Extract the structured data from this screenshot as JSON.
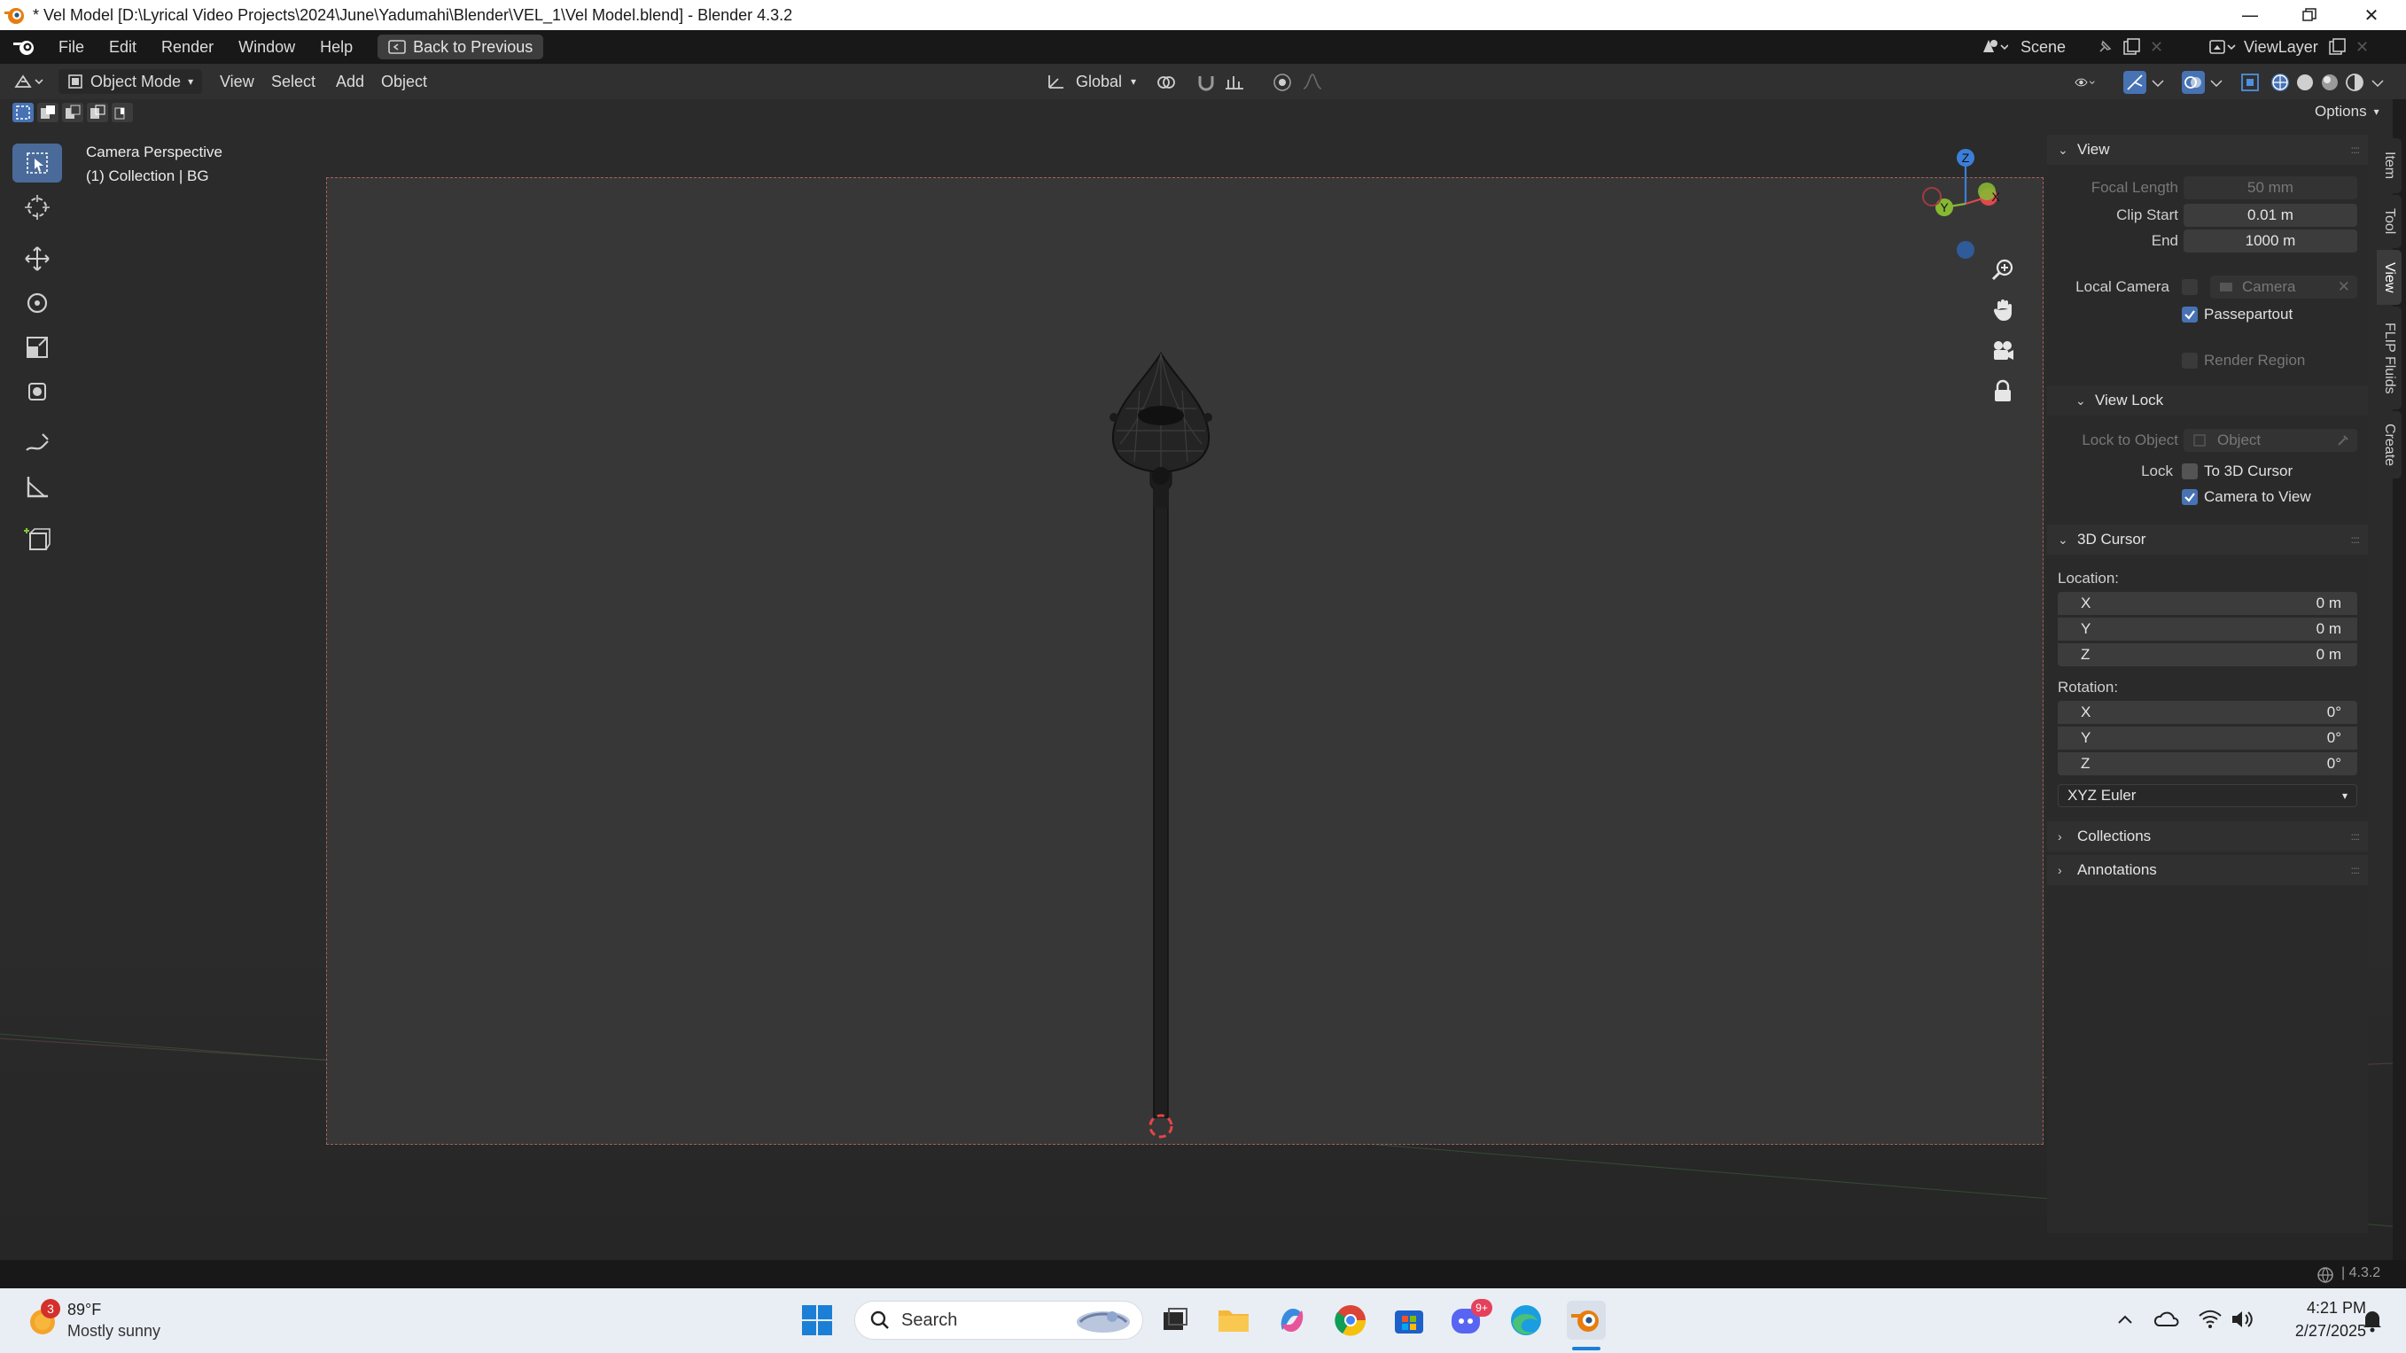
{
  "window": {
    "title": "* Vel Model [D:\\Lyrical Video Projects\\2024\\June\\Yadumahi\\Blender\\VEL_1\\Vel Model.blend] - Blender 4.3.2",
    "controls": [
      "minimize-icon",
      "restore-icon",
      "close-icon"
    ]
  },
  "menubar": {
    "items": [
      "File",
      "Edit",
      "Render",
      "Window",
      "Help"
    ],
    "back_button": "Back to Previous",
    "scene_label": "Scene",
    "view_layer_label": "ViewLayer"
  },
  "header": {
    "mode": "Object Mode",
    "menus": [
      "View",
      "Select",
      "Add",
      "Object"
    ],
    "transform_orientation": "Global",
    "options_label": "Options"
  },
  "viewport": {
    "camera_label": "Camera Perspective",
    "collection_label": "(1) Collection | BG",
    "gizmo": {
      "z": "Z",
      "y": "Y",
      "x": "X"
    },
    "left_tools": [
      "select-box-icon",
      "cursor-icon",
      "move-icon",
      "rotate-icon",
      "scale-icon",
      "transform-icon",
      "annotate-icon",
      "measure-icon",
      "add-cube-icon"
    ],
    "nav_controls": [
      "zoom-icon",
      "pan-hand-icon",
      "camera-view-icon",
      "lock-icon"
    ]
  },
  "sidebar": {
    "tabs": [
      "Item",
      "Tool",
      "View",
      "FLIP Fluids",
      "Create"
    ],
    "active_tab": "View",
    "view_panel": {
      "title": "View",
      "focal_length_label": "Focal Length",
      "focal_length_value": "50 mm",
      "clip_start_label": "Clip Start",
      "clip_start_value": "0.01 m",
      "end_label": "End",
      "end_value": "1000 m",
      "local_camera_label": "Local Camera",
      "local_camera_value": "Camera",
      "passepartout_label": "Passepartout",
      "passepartout_checked": true,
      "render_region_label": "Render Region",
      "render_region_checked": false
    },
    "view_lock": {
      "title": "View Lock",
      "lock_to_object_label": "Lock to Object",
      "lock_to_object_placeholder": "Object",
      "lock_label": "Lock",
      "to_3d_cursor_label": "To 3D Cursor",
      "to_3d_cursor_checked": false,
      "camera_to_view_label": "Camera to View",
      "camera_to_view_checked": true
    },
    "cursor_panel": {
      "title": "3D Cursor",
      "location_label": "Location:",
      "location": [
        {
          "axis": "X",
          "value": "0 m"
        },
        {
          "axis": "Y",
          "value": "0 m"
        },
        {
          "axis": "Z",
          "value": "0 m"
        }
      ],
      "rotation_label": "Rotation:",
      "rotation": [
        {
          "axis": "X",
          "value": "0°"
        },
        {
          "axis": "Y",
          "value": "0°"
        },
        {
          "axis": "Z",
          "value": "0°"
        }
      ],
      "rotation_mode": "XYZ Euler"
    },
    "collapsed_panels": [
      "Collections",
      "Annotations"
    ]
  },
  "statusbar": {
    "version": "4.3.2"
  },
  "taskbar": {
    "weather_badge": "3",
    "weather_temp": "89°F",
    "weather_desc": "Mostly sunny",
    "search_label": "Search",
    "discord_badge": "9+",
    "time": "4:21 PM",
    "date": "2/27/2025"
  },
  "colors": {
    "accent": "#4772b3",
    "gizmo_x": "#e0484f",
    "gizmo_y": "#87b733",
    "gizmo_z": "#3c7fd8",
    "camera_border": "#a8605f"
  }
}
